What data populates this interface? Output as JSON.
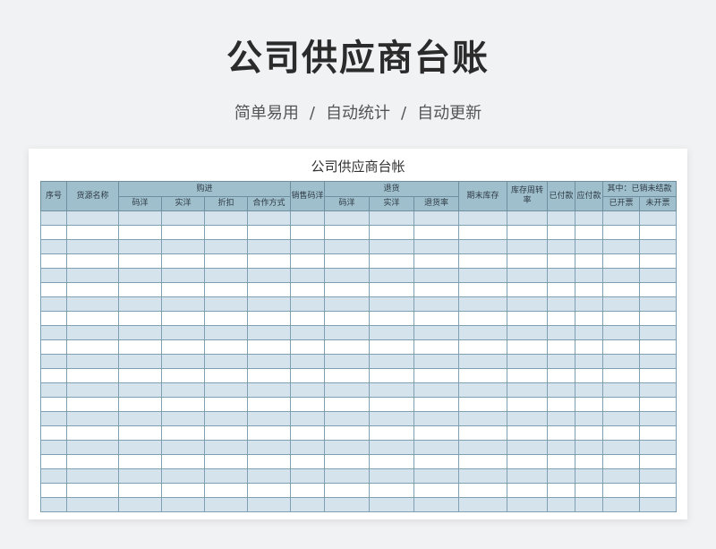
{
  "page": {
    "title": "公司供应商台账",
    "tags": [
      "简单易用",
      "自动统计",
      "自动更新"
    ],
    "separator": "/"
  },
  "sheet": {
    "title": "公司供应商台帐",
    "headers": {
      "index": "序号",
      "source_name": "货源名称",
      "purchase": "购进",
      "purchase_code_price": "码洋",
      "purchase_real_price": "实洋",
      "purchase_discount": "折扣",
      "purchase_method": "合作方式",
      "sales_code_price": "销售码洋",
      "returns": "退货",
      "returns_code_price": "码洋",
      "returns_real_price": "实洋",
      "returns_rate": "退货率",
      "ending_stock": "期末库存",
      "stock_turnover": "库存周转率",
      "paid": "已付款",
      "payable": "应付款",
      "unsettled": "其中：已销未结款",
      "invoiced": "已开票",
      "not_invoiced": "未开票"
    },
    "row_count": 21
  },
  "colors": {
    "header_bg": "#9fbfcd",
    "row_alt_bg": "#d5e3ec",
    "page_bg": "#f1f2f4"
  }
}
